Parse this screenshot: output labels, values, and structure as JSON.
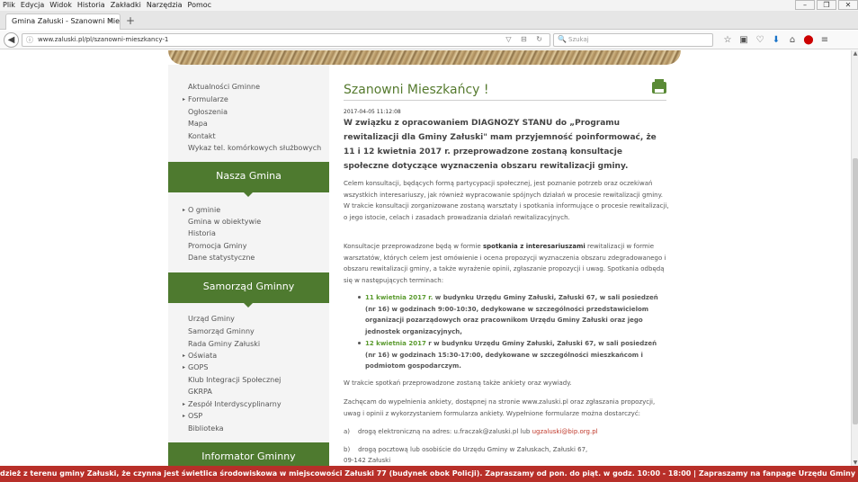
{
  "menubar": {
    "items": [
      "Plik",
      "Edycja",
      "Widok",
      "Historia",
      "Zakładki",
      "Narzędzia",
      "Pomoc"
    ]
  },
  "tab": {
    "title": "Gmina Załuski - Szanowni Mies...",
    "close": "×",
    "new": "+"
  },
  "urlbar": {
    "url": "www.zaluski.pl/pl/szanowni-mieszkancy-1",
    "info": "ⓘ",
    "icons": "▽ ⊟ ↻"
  },
  "search": {
    "placeholder": "Szukaj"
  },
  "toolbar_icons": [
    "star-icon",
    "reading-list-icon",
    "pocket-icon",
    "download-icon",
    "home-icon",
    "adblock-icon",
    "menu-icon"
  ],
  "sidebar": {
    "links_top": [
      "Aktualności Gminne",
      "Formularze",
      "Ogłoszenia",
      "Mapa",
      "Kontakt",
      "Wykaz tel. komórkowych służbowych"
    ],
    "section1": "Nasza Gmina",
    "links_mid": [
      "O gminie",
      "Gmina w obiektywie",
      "Historia",
      "Promocja Gminy",
      "Dane statystyczne"
    ],
    "section2": "Samorząd Gminny",
    "links_bottom": [
      "Urząd Gminy",
      "Samorząd Gminny",
      "Rada Gminy Załuski",
      "Oświata",
      "GOPS",
      "Klub Integracji Społecznej",
      "GKRPA",
      "Zespół Interdyscyplinarny",
      "OSP",
      "Biblioteka"
    ],
    "section3": "Informator Gminny"
  },
  "article": {
    "title": "Szanowni Mieszkańcy !",
    "date": "2017-04-05 11:12:08",
    "lead": "W związku z opracowaniem DIAGNOZY STANU do „Programu rewitalizacji dla Gminy Załuski\" mam przyjemność poinformować, że 11 i 12 kwietnia 2017 r. przeprowadzone zostaną konsultacje społeczne dotyczące wyznaczenia obszaru rewitalizacji gminy.",
    "p1": "Celem konsultacji, będących formą partycypacji społecznej, jest poznanie potrzeb oraz oczekiwań wszystkich interesariuszy, jak również wypracowanie spójnych działań w procesie rewitalizacji gminy. W trakcie konsultacji zorganizowane zostaną warsztaty i spotkania informujące o procesie rewitalizacji, o jego istocie, celach i zasadach prowadzania działań rewitalizacyjnych.",
    "p2a": "Konsultacje przeprowadzone będą w formie ",
    "p2b": "spotkania z interesariuszami",
    "p2c": " rewitalizacji w formie warsztatów, których celem jest omówienie i ocena propozycji wyznaczenia obszaru zdegradowanego i obszaru rewitalizacji gminy, a także wyrażenie opinii, zgłaszanie propozycji i uwag. Spotkania odbędą się w następujących terminach:",
    "b1date": "11 kwietnia 2017 r.",
    "b1text": " w budynku Urzędu Gminy Załuski, Załuski 67, w sali posiedzeń (nr 16) w godzinach 9:00-10:30, dedykowane w szczególności przedstawicielom organizacji pozarządowych oraz pracownikom Urzędu Gminy Załuski oraz jego jednostek organizacyjnych,",
    "b2date": "12 kwietnia 2017",
    "b2text": " r w budynku Urzędu Gminy Załuski, Załuski 67, w sali posiedzeń (nr 16) w godzinach 15:30-17:00, dedykowane w szczególności mieszkańcom i podmiotom gospodarczym.",
    "p3": "W trakcie spotkań przeprowadzone zostaną także ankiety oraz wywiady.",
    "p4": "Zachęcam do wypełnienia ankiety, dostępnej na stronie www.zaluski.pl oraz zgłaszania propozycji, uwag i opinii z wykorzystaniem formularza ankiety. Wypełnione formularze można dostarczyć:",
    "a_label": "a)",
    "a_text": "drogą elektroniczną na adres: u.fraczak@zaluski.pl lub ",
    "a_mail": "ugzaluski@bip.org.pl",
    "b_label": "b)",
    "b_text": "drogą pocztową lub osobiście do Urzędu Gminy w Załuskach, Załuski 67,",
    "b_text2": "09-142 Załuski"
  },
  "ticker": {
    "text": "dzież z terenu gminy Załuski, że czynna jest świetlica środowiskowa w miejscowości Załuski 77 (budynek obok Policji). Zapraszamy od pon. do piąt. w godz. 10:00 - 18:00      |      Zapraszamy na fanpage Urzędu Gminy Załuski na facebooku. Adres: ht"
  }
}
